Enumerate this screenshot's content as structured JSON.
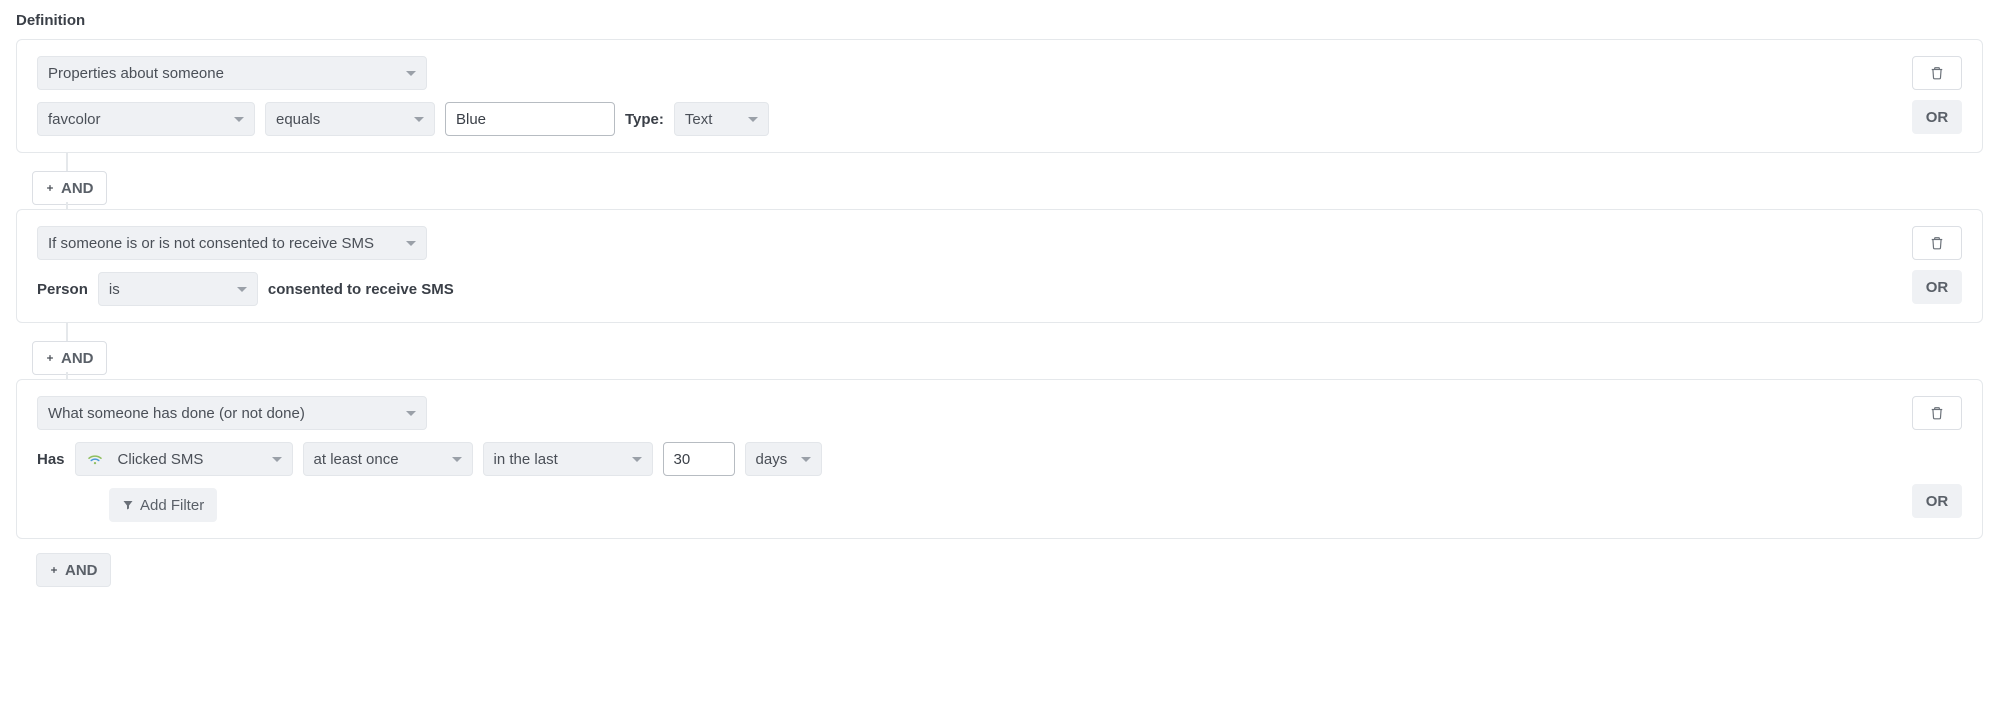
{
  "section_title": "Definition",
  "buttons": {
    "and": "AND",
    "or": "OR",
    "add_filter": "Add Filter"
  },
  "labels": {
    "type": "Type:",
    "person": "Person",
    "has": "Has",
    "consented_suffix": "consented to receive SMS"
  },
  "card1": {
    "condition_type": "Properties about someone",
    "property": "favcolor",
    "operator": "equals",
    "value": "Blue",
    "value_type": "Text"
  },
  "card2": {
    "condition_type": "If someone is or is not consented to receive SMS",
    "is_state": "is"
  },
  "card3": {
    "condition_type": "What someone has done (or not done)",
    "event": "Clicked SMS",
    "frequency": "at least once",
    "time_operator": "in the last",
    "time_value": "30",
    "time_unit": "days"
  }
}
